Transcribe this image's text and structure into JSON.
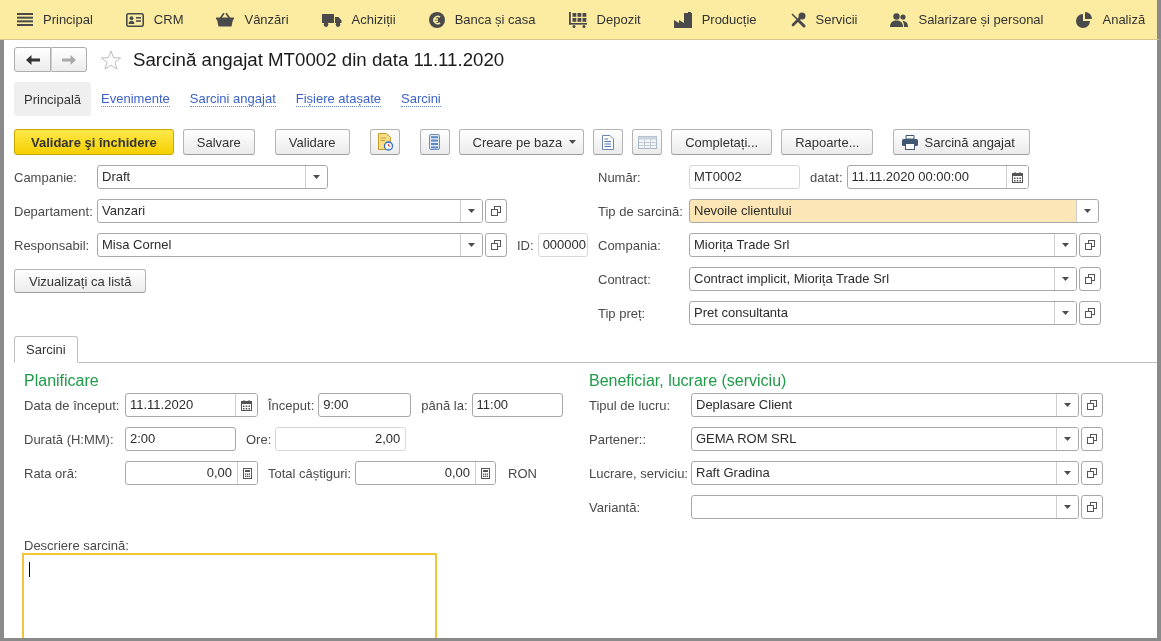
{
  "menu_bar": {
    "items": [
      {
        "label": "Principal",
        "selected": false
      },
      {
        "label": "CRM",
        "selected": false
      },
      {
        "label": "Vânzări",
        "selected": false
      },
      {
        "label": "Achiziții",
        "selected": false
      },
      {
        "label": "Banca și casa",
        "selected": false
      },
      {
        "label": "Depozit",
        "selected": false
      },
      {
        "label": "Producție",
        "selected": false
      },
      {
        "label": "Servicii",
        "selected": false
      },
      {
        "label": "Salarizare și personal",
        "selected": false
      },
      {
        "label": "Analiză",
        "selected": false
      }
    ]
  },
  "form": {
    "history": {
      "back_disabled": false,
      "forward_disabled": true
    },
    "favorite": false,
    "title": "Sarcină angajat MT0002 din data 11.11.2020",
    "nav_tabs": [
      {
        "label": "Principală",
        "selected": true
      },
      {
        "label": "Evenimente",
        "selected": false
      },
      {
        "label": "Sarcini angajat",
        "selected": false
      },
      {
        "label": "Fișiere atașate",
        "selected": false
      },
      {
        "label": "Sarcini",
        "selected": false
      }
    ],
    "toolbar": [
      {
        "kind": "primary",
        "label": "Validare şi închidere"
      },
      {
        "kind": "plain",
        "label": "Salvare"
      },
      {
        "kind": "plain",
        "label": "Validare"
      },
      {
        "kind": "icon"
      },
      {
        "kind": "icon"
      },
      {
        "kind": "menu",
        "label": "Creare pe baza"
      },
      {
        "kind": "icon"
      },
      {
        "kind": "icon"
      },
      {
        "kind": "plain",
        "label": "Completați..."
      },
      {
        "kind": "plain",
        "label": "Rapoarte..."
      },
      {
        "kind": "print",
        "label": "Sarcină angajat"
      }
    ],
    "header_left": [
      [
        {
          "label": "Campanie:",
          "kind": "select",
          "value": "Draft",
          "readonly": false
        }
      ],
      [
        {
          "label": "Departament:",
          "kind": "reference",
          "value": "Vanzari",
          "readonly": false
        }
      ],
      [
        {
          "label": "Responsabil:",
          "kind": "reference",
          "value": "Misa Cornel",
          "readonly": false
        },
        {
          "label": "ID:",
          "kind": "text",
          "value": "000000",
          "readonly": true
        }
      ]
    ],
    "list_button": "Vizualizați ca listă",
    "header_right": [
      [
        {
          "label": "Număr:",
          "kind": "text",
          "value": "MT0002",
          "readonly": true,
          "highlighted": false
        },
        {
          "label": "datat:",
          "kind": "date",
          "value": "11.11.2020 00:00:00",
          "readonly": false,
          "highlighted": false
        }
      ],
      [
        {
          "label": "Tip de sarcină:",
          "kind": "select",
          "value": "Nevoile clientului",
          "readonly": false,
          "highlighted": true
        }
      ],
      [
        {
          "label": "Compania:",
          "kind": "reference",
          "value": "Miorița Trade Srl",
          "readonly": false,
          "highlighted": false
        }
      ],
      [
        {
          "label": "Contract:",
          "kind": "reference",
          "value": "Contract implicit, Miorița Trade Srl",
          "readonly": false,
          "highlighted": false
        }
      ],
      [
        {
          "label": "Tip preț:",
          "kind": "reference",
          "value": "Pret consultanta",
          "readonly": false,
          "highlighted": false
        }
      ]
    ],
    "section_tabs": [
      {
        "label": "Sarcini",
        "selected": true
      }
    ],
    "planning": {
      "heading": "Planificare",
      "rows": [
        [
          {
            "label": "Data de început:",
            "kind": "date",
            "value": "11.11.2020",
            "readonly": false
          },
          {
            "label": "Început:",
            "kind": "text",
            "value": "9:00",
            "readonly": false
          },
          {
            "label": "până la:",
            "kind": "text",
            "value": "11:00",
            "readonly": false
          }
        ],
        [
          {
            "label": "Durată (H:MM):",
            "kind": "text",
            "value": "2:00",
            "readonly": false
          },
          {
            "label": "Ore:",
            "kind": "number",
            "value": "2,00",
            "readonly": true
          }
        ],
        [
          {
            "label": "Rata oră:",
            "kind": "calc",
            "value": "0,00",
            "readonly": false
          },
          {
            "label": "Total câștiguri:",
            "kind": "calc",
            "value": "0,00",
            "readonly": false,
            "unit": "RON"
          }
        ]
      ]
    },
    "beneficiary": {
      "heading": "Beneficiar, lucrare (serviciu)",
      "rows": [
        [
          {
            "label": "Tipul de lucru:",
            "kind": "reference",
            "value": "Deplasare Client",
            "readonly": false
          }
        ],
        [
          {
            "label": "Partener::",
            "kind": "reference",
            "value": "GEMA ROM SRL",
            "readonly": false
          }
        ],
        [
          {
            "label": "Lucrare, serviciu:",
            "kind": "reference",
            "value": "Raft Gradina",
            "readonly": false
          }
        ],
        [
          {
            "label": "Variantă:",
            "kind": "reference",
            "readonly": false
          }
        ]
      ]
    },
    "description": {
      "label": "Descriere sarcină:",
      "focused": true
    }
  }
}
